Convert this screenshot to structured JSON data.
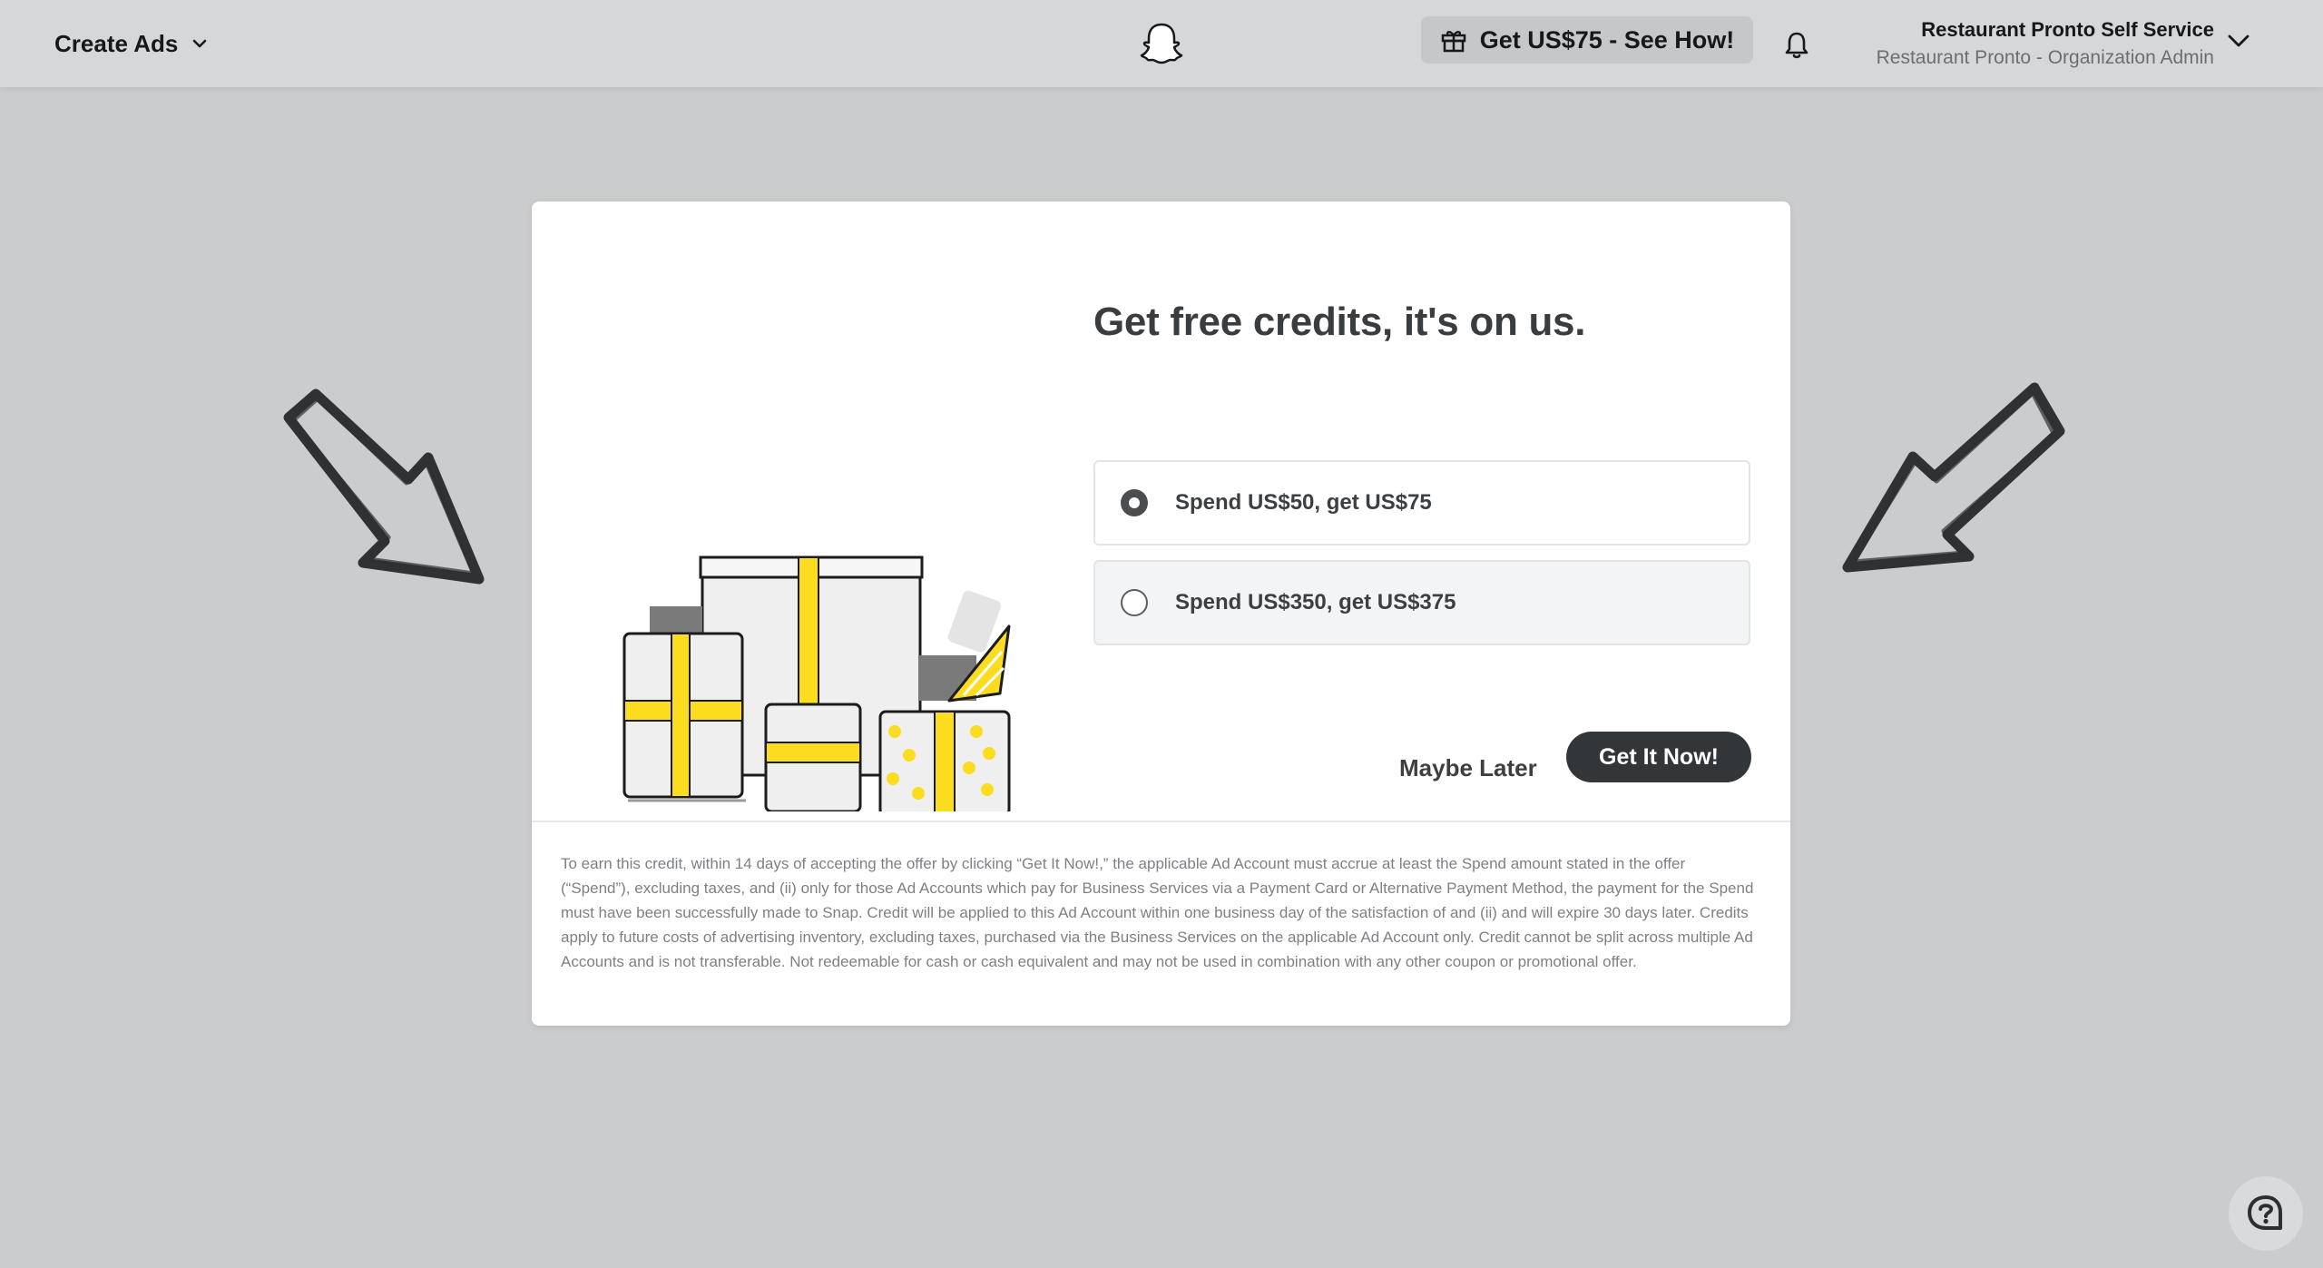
{
  "header": {
    "menu_label": "Create Ads",
    "promo_label": "Get US$75 - See How!",
    "account_name": "Restaurant Pronto Self Service",
    "account_role": "Restaurant Pronto - Organization Admin"
  },
  "modal": {
    "title": "Get free credits, it's on us.",
    "options": [
      {
        "label": "Spend US$50, get US$75",
        "selected": true
      },
      {
        "label": "Spend US$350, get US$375",
        "selected": false
      }
    ],
    "secondary_button": "Maybe Later",
    "primary_button": "Get It Now!",
    "terms": "To earn this credit, within 14 days of accepting the offer by clicking “Get It Now!,” the applicable Ad Account must accrue at least the Spend amount stated in the offer (“Spend”), excluding taxes, and (ii) only for those Ad Accounts which pay for Business Services via a Payment Card or Alternative Payment Method, the payment for the Spend must have been successfully made to Snap. Credit will be applied to this Ad Account within one business day of the satisfaction of and (ii) and will expire 30 days later. Credits apply to future costs of advertising inventory, excluding taxes, purchased via the Business Services on the applicable Ad Account only. Credit cannot be split across multiple Ad Accounts and is not transferable. Not redeemable for cash or cash equivalent and may not be used in combination with any other coupon or promotional offer."
  },
  "icons": {
    "menu_chevron": "chevron-down-icon",
    "logo": "snapchat-ghost-icon",
    "promo": "gift-icon",
    "notifications": "bell-icon",
    "account_chevron": "chevron-down-icon",
    "help": "help-chat-icon"
  },
  "colors": {
    "background": "#cbcccd",
    "header": "#d6d7d8",
    "primary_button": "#333639",
    "accent_yellow": "#fcdc1f"
  }
}
